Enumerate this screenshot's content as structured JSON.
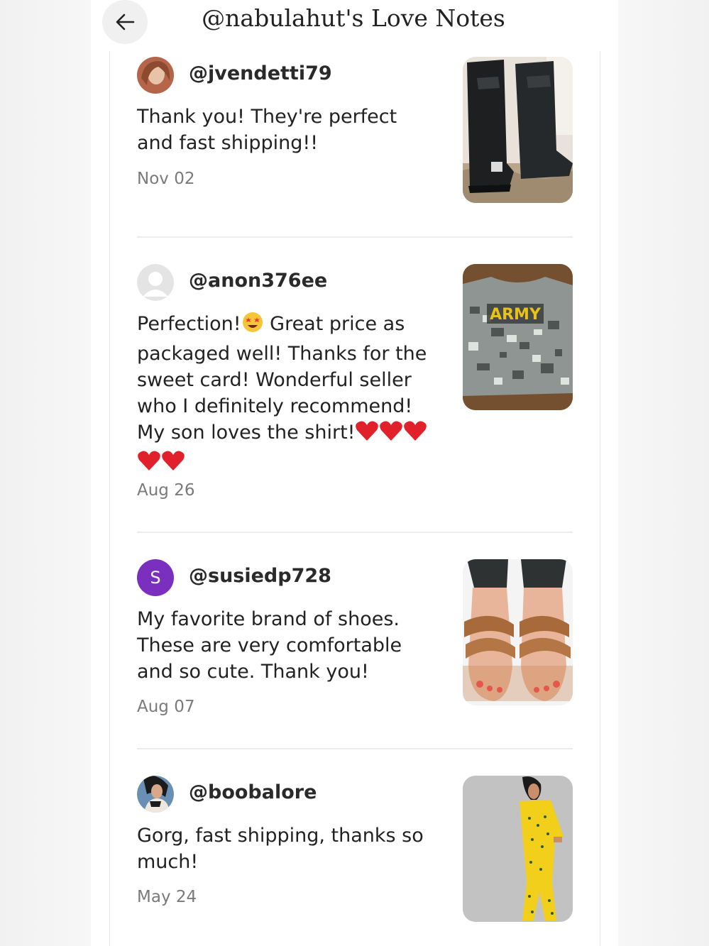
{
  "header": {
    "title": "@nabulahut's Love Notes",
    "back_icon": "arrow-left-icon"
  },
  "notes": [
    {
      "username": "@jvendetti79",
      "comment": "Thank you! They're perfect and fast shipping!!",
      "date": "Nov 02",
      "avatar": "user-photo-avatar",
      "thumbnail": "black-knee-high-boots"
    },
    {
      "username": "@anon376ee",
      "comment_parts": [
        "Perfection!",
        "Great price as packaged well! Thanks for the sweet card! Wonderful seller who I definitely recommend! My son loves the shirt!"
      ],
      "emoji": [
        "star-struck-emoji",
        "red-heart-emoji x5"
      ],
      "date": "Aug 26",
      "avatar": "default-avatar",
      "thumbnail": "camo-army-t-shirt",
      "thumbnail_text": "ARMY"
    },
    {
      "username": "@susiedp728",
      "comment": "My favorite brand of shoes. These are very comfortable and so cute. Thank you!",
      "date": "Aug 07",
      "avatar": "letter-avatar",
      "avatar_letter": "S",
      "avatar_color": "#7b2fbe",
      "thumbnail": "tan-strappy-sandals"
    },
    {
      "username": "@boobalore",
      "comment": "Gorg, fast shipping, thanks so much!",
      "date": "May 24",
      "avatar": "user-photo-avatar",
      "thumbnail": "yellow-print-pajama-set"
    }
  ]
}
